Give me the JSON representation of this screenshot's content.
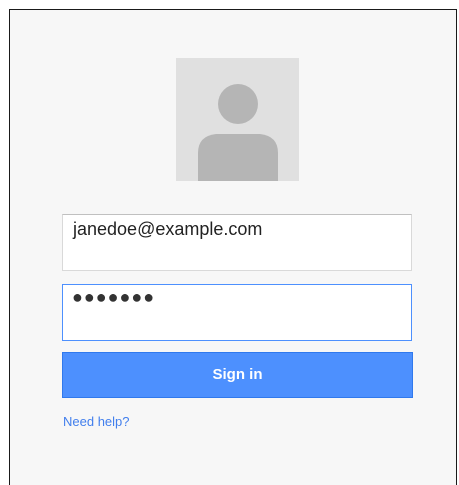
{
  "login": {
    "avatar_icon": "default-user-avatar-icon",
    "email": {
      "value": "janedoe@example.com"
    },
    "password": {
      "masked_value": "●●●●●●●"
    },
    "signin_label": "Sign in",
    "help_label": "Need help?"
  },
  "colors": {
    "card_background": "#f7f7f7",
    "avatar_background": "#e0e0e0",
    "avatar_figure": "#b5b5b5",
    "primary_button": "#4d90fe",
    "focus_border": "#4d90fe",
    "link": "#427fed"
  }
}
